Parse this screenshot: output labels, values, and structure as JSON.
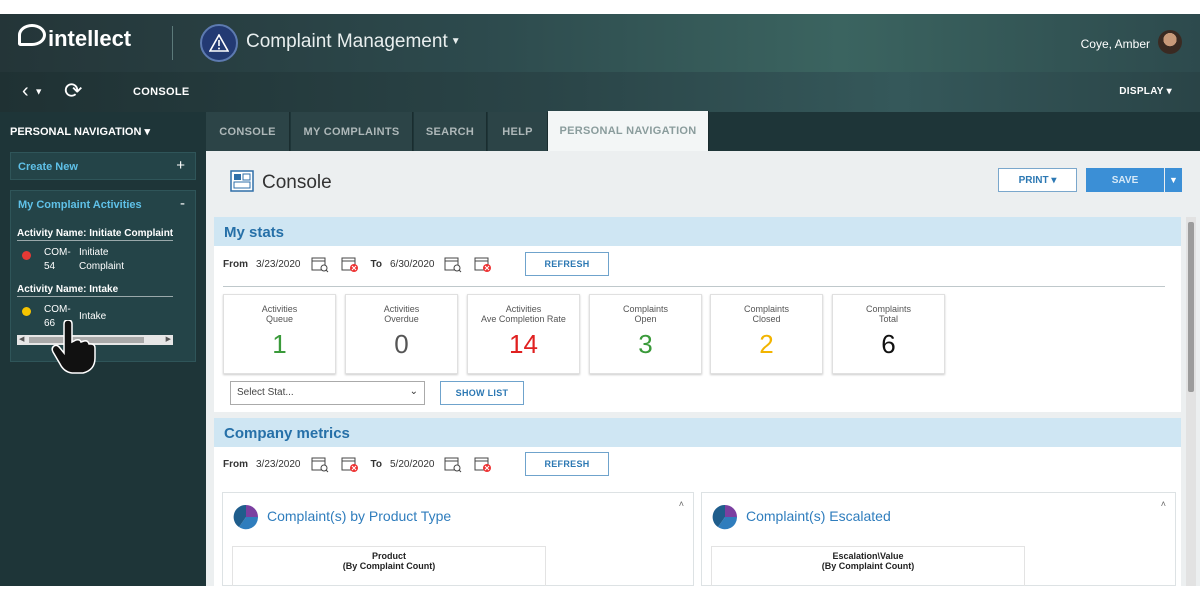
{
  "header": {
    "logo_text": "intellect",
    "app_title": "Complaint Management",
    "user_name": "Coye, Amber"
  },
  "subbar": {
    "current_page": "CONSOLE",
    "display_label": "DISPLAY"
  },
  "sidebar": {
    "title": "PERSONAL NAVIGATION",
    "create_new": "Create New",
    "activities_header": "My Complaint Activities",
    "activities": [
      {
        "name": "Activity Name: Initiate Complaint",
        "id_line1": "COM-",
        "id_line2": "54",
        "desc_line1": "Initiate",
        "desc_line2": "Complaint",
        "status_color": "#e53935"
      },
      {
        "name": "Activity Name: Intake",
        "id_line1": "COM-",
        "id_line2": "66",
        "desc_line1": "Intake",
        "desc_line2": "",
        "status_color": "#f5c400"
      }
    ]
  },
  "tabs": [
    {
      "label": "CONSOLE",
      "active": false
    },
    {
      "label": "MY COMPLAINTS",
      "active": false
    },
    {
      "label": "SEARCH",
      "active": false
    },
    {
      "label": "HELP",
      "active": false
    },
    {
      "label": "PERSONAL NAVIGATION",
      "active": true
    }
  ],
  "console": {
    "title": "Console",
    "print_label": "PRINT",
    "save_label": "SAVE"
  },
  "my_stats": {
    "title": "My stats",
    "from_label": "From",
    "from_date": "3/23/2020",
    "to_label": "To",
    "to_date": "6/30/2020",
    "refresh_label": "REFRESH",
    "cards": [
      {
        "title_line1": "Activities",
        "title_line2": "Queue",
        "value": "1",
        "color": "#3a9a3a"
      },
      {
        "title_line1": "Activities",
        "title_line2": "Overdue",
        "value": "0",
        "color": "#555555"
      },
      {
        "title_line1": "Activities",
        "title_line2": "Ave Completion Rate",
        "value": "14",
        "color": "#e02020"
      },
      {
        "title_line1": "Complaints",
        "title_line2": "Open",
        "value": "3",
        "color": "#3a9a3a"
      },
      {
        "title_line1": "Complaints",
        "title_line2": "Closed",
        "value": "2",
        "color": "#f2b400"
      },
      {
        "title_line1": "Complaints",
        "title_line2": "Total",
        "value": "6",
        "color": "#111111"
      }
    ],
    "select_placeholder": "Select Stat...",
    "show_list_label": "SHOW LIST"
  },
  "company_metrics": {
    "title": "Company metrics",
    "from_label": "From",
    "from_date": "3/23/2020",
    "to_label": "To",
    "to_date": "5/20/2020",
    "refresh_label": "REFRESH",
    "widgets": [
      {
        "title": "Complaint(s) by Product Type",
        "chart_title_line1": "Product",
        "chart_title_line2": "(By Complaint Count)"
      },
      {
        "title": "Complaint(s) Escalated",
        "chart_title_line1": "Escalation\\Value",
        "chart_title_line2": "(By Complaint Count)"
      }
    ]
  }
}
